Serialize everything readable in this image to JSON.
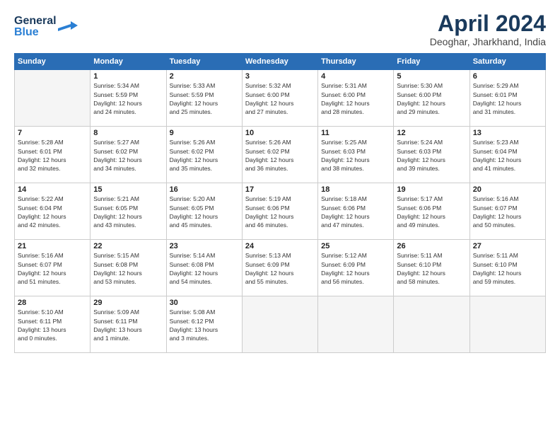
{
  "logo": {
    "line1": "General",
    "line2": "Blue"
  },
  "title": "April 2024",
  "location": "Deoghar, Jharkhand, India",
  "days_header": [
    "Sunday",
    "Monday",
    "Tuesday",
    "Wednesday",
    "Thursday",
    "Friday",
    "Saturday"
  ],
  "weeks": [
    [
      {
        "num": "",
        "info": ""
      },
      {
        "num": "1",
        "info": "Sunrise: 5:34 AM\nSunset: 5:59 PM\nDaylight: 12 hours\nand 24 minutes."
      },
      {
        "num": "2",
        "info": "Sunrise: 5:33 AM\nSunset: 5:59 PM\nDaylight: 12 hours\nand 25 minutes."
      },
      {
        "num": "3",
        "info": "Sunrise: 5:32 AM\nSunset: 6:00 PM\nDaylight: 12 hours\nand 27 minutes."
      },
      {
        "num": "4",
        "info": "Sunrise: 5:31 AM\nSunset: 6:00 PM\nDaylight: 12 hours\nand 28 minutes."
      },
      {
        "num": "5",
        "info": "Sunrise: 5:30 AM\nSunset: 6:00 PM\nDaylight: 12 hours\nand 29 minutes."
      },
      {
        "num": "6",
        "info": "Sunrise: 5:29 AM\nSunset: 6:01 PM\nDaylight: 12 hours\nand 31 minutes."
      }
    ],
    [
      {
        "num": "7",
        "info": "Sunrise: 5:28 AM\nSunset: 6:01 PM\nDaylight: 12 hours\nand 32 minutes."
      },
      {
        "num": "8",
        "info": "Sunrise: 5:27 AM\nSunset: 6:02 PM\nDaylight: 12 hours\nand 34 minutes."
      },
      {
        "num": "9",
        "info": "Sunrise: 5:26 AM\nSunset: 6:02 PM\nDaylight: 12 hours\nand 35 minutes."
      },
      {
        "num": "10",
        "info": "Sunrise: 5:26 AM\nSunset: 6:02 PM\nDaylight: 12 hours\nand 36 minutes."
      },
      {
        "num": "11",
        "info": "Sunrise: 5:25 AM\nSunset: 6:03 PM\nDaylight: 12 hours\nand 38 minutes."
      },
      {
        "num": "12",
        "info": "Sunrise: 5:24 AM\nSunset: 6:03 PM\nDaylight: 12 hours\nand 39 minutes."
      },
      {
        "num": "13",
        "info": "Sunrise: 5:23 AM\nSunset: 6:04 PM\nDaylight: 12 hours\nand 41 minutes."
      }
    ],
    [
      {
        "num": "14",
        "info": "Sunrise: 5:22 AM\nSunset: 6:04 PM\nDaylight: 12 hours\nand 42 minutes."
      },
      {
        "num": "15",
        "info": "Sunrise: 5:21 AM\nSunset: 6:05 PM\nDaylight: 12 hours\nand 43 minutes."
      },
      {
        "num": "16",
        "info": "Sunrise: 5:20 AM\nSunset: 6:05 PM\nDaylight: 12 hours\nand 45 minutes."
      },
      {
        "num": "17",
        "info": "Sunrise: 5:19 AM\nSunset: 6:06 PM\nDaylight: 12 hours\nand 46 minutes."
      },
      {
        "num": "18",
        "info": "Sunrise: 5:18 AM\nSunset: 6:06 PM\nDaylight: 12 hours\nand 47 minutes."
      },
      {
        "num": "19",
        "info": "Sunrise: 5:17 AM\nSunset: 6:06 PM\nDaylight: 12 hours\nand 49 minutes."
      },
      {
        "num": "20",
        "info": "Sunrise: 5:16 AM\nSunset: 6:07 PM\nDaylight: 12 hours\nand 50 minutes."
      }
    ],
    [
      {
        "num": "21",
        "info": "Sunrise: 5:16 AM\nSunset: 6:07 PM\nDaylight: 12 hours\nand 51 minutes."
      },
      {
        "num": "22",
        "info": "Sunrise: 5:15 AM\nSunset: 6:08 PM\nDaylight: 12 hours\nand 53 minutes."
      },
      {
        "num": "23",
        "info": "Sunrise: 5:14 AM\nSunset: 6:08 PM\nDaylight: 12 hours\nand 54 minutes."
      },
      {
        "num": "24",
        "info": "Sunrise: 5:13 AM\nSunset: 6:09 PM\nDaylight: 12 hours\nand 55 minutes."
      },
      {
        "num": "25",
        "info": "Sunrise: 5:12 AM\nSunset: 6:09 PM\nDaylight: 12 hours\nand 56 minutes."
      },
      {
        "num": "26",
        "info": "Sunrise: 5:11 AM\nSunset: 6:10 PM\nDaylight: 12 hours\nand 58 minutes."
      },
      {
        "num": "27",
        "info": "Sunrise: 5:11 AM\nSunset: 6:10 PM\nDaylight: 12 hours\nand 59 minutes."
      }
    ],
    [
      {
        "num": "28",
        "info": "Sunrise: 5:10 AM\nSunset: 6:11 PM\nDaylight: 13 hours\nand 0 minutes."
      },
      {
        "num": "29",
        "info": "Sunrise: 5:09 AM\nSunset: 6:11 PM\nDaylight: 13 hours\nand 1 minute."
      },
      {
        "num": "30",
        "info": "Sunrise: 5:08 AM\nSunset: 6:12 PM\nDaylight: 13 hours\nand 3 minutes."
      },
      {
        "num": "",
        "info": ""
      },
      {
        "num": "",
        "info": ""
      },
      {
        "num": "",
        "info": ""
      },
      {
        "num": "",
        "info": ""
      }
    ]
  ]
}
